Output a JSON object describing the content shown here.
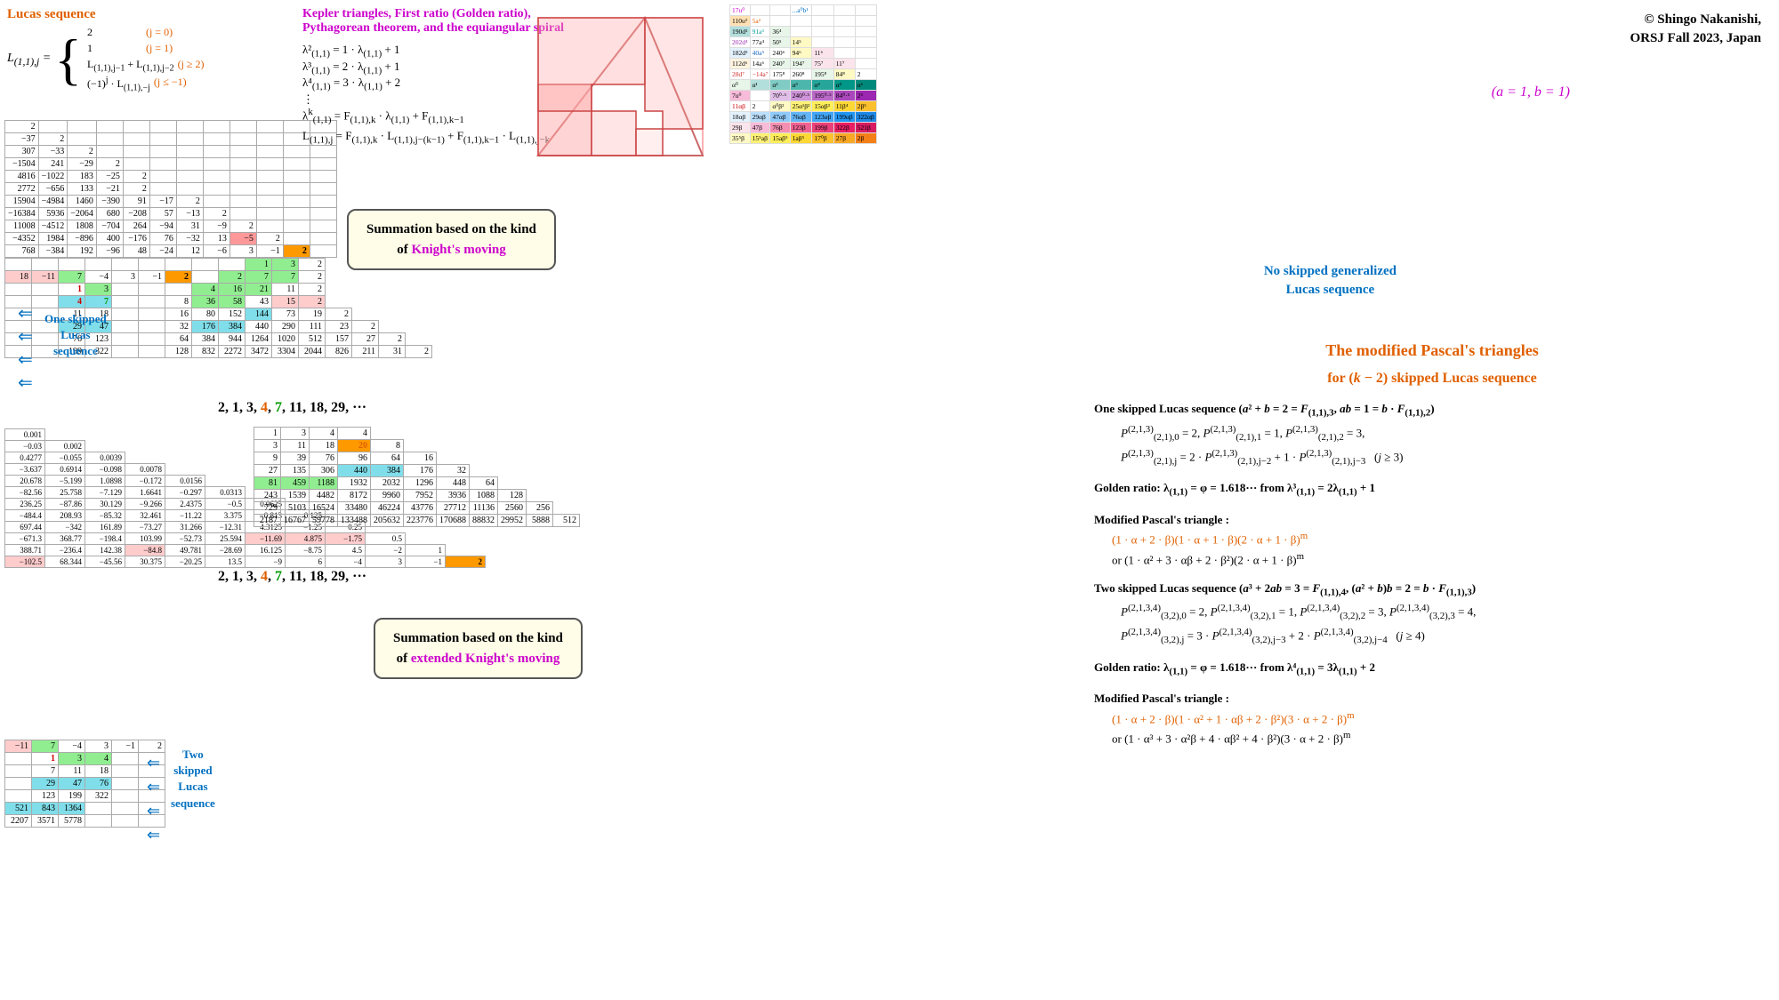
{
  "copyright": {
    "line1": "© Shingo Nakanishi,",
    "line2": "ORSJ Fall 2023, Japan"
  },
  "lucas_title": "Lucas sequence",
  "lucas_subscript": "(1,1),j",
  "ab_label": "(a = 1, b = 1)",
  "kepler_title": "Kepler triangles, First ratio (Golden ratio),",
  "kepler_subtitle": "Pythagorean theorem, and the equiangular spiral",
  "kepler_formulas": [
    "λ²(1,1) = 1 · λ(1,1) + 1",
    "λ³(1,1) = 2 · λ(1,1) + 1",
    "λ⁴(1,1) = 3 · λ(1,1) + 2",
    "⋮",
    "λᵏ(1,1) = F(1,1),k · λ(1,1) + F(1,1),k−1",
    "L(1,1),j = F(1,1),k · L(1,1),j−(k−1) + F(1,1),k−1 · L(1,1),j−k"
  ],
  "callout1": {
    "line1": "Summation based on the kind",
    "line2": "of Knight's moving",
    "highlight": "Knight's moving"
  },
  "callout2": {
    "line1": "Summation based on the kind",
    "line2": "of extended Knight's moving",
    "highlight": "extended Knight's moving"
  },
  "no_skipped_label": "No skipped generalized\nLucas sequence",
  "one_skipped_label": "One skipped\nLucas\nsequence",
  "two_skipped_label": "Two\nskipped\nLucas\nsequence",
  "sequence1": "2, 1, 3, 4, 7, 11, 18, 29, ···",
  "sequence2": "2, 1, 3, 4, 7, 11, 18, 29, ···",
  "modified_title": "The modified Pascal's triangles",
  "modified_subtitle": "for (k − 2) skipped Lucas sequence",
  "formula_blocks": {
    "one_skipped": {
      "label": "One skipped Lucas sequence (a² + b = 2 = F(1,1),3, ab = 1 = b · F(1,1),2)",
      "lines": [
        "P(2,1,3)(2,1),0 = 2, P(2,1,3)(2,1),1 = 1, P(2,1,3)(2,1),2 = 3,",
        "P(2,1,3)(2,1),j = 2 · P(2,1,3)(2,1),j−2 + 1 · P(2,1,3)(2,1),j−3   (j ≥ 3)"
      ]
    },
    "golden_ratio1": {
      "label": "Golden ratio: λ(1,1) = φ = 1.618··· from λ³(1,1) = 2λ(1,1) + 1"
    },
    "modified_triangle1": {
      "label": "Modified Pascal's triangle :",
      "lines": [
        "(1 · α + 2 · β)(1 · α + 1 · β)(2 · α + 1 · β)ᵐ",
        "or (1 · α² + 3 · αβ + 2 · β²)(2 · α + 1 · β)ᵐ"
      ]
    },
    "two_skipped": {
      "label": "Two skipped Lucas sequence (a³ + 2ab = 3 = F(1,1),4, (a² + b)b = 2 = b · F(1,1),3)",
      "lines": [
        "P(2,1,3,4)(3,2),0 = 2, P(2,1,3,4)(3,2),1 = 1, P(2,1,3,4)(3,2),2 = 3, P(2,1,3,4)(3,2),3 = 4,",
        "P(2,1,3,4)(3,2),j = 3 · P(2,1,3,4)(3,2),j−3 + 2 · P(2,1,3,4)(3,2),j−4   (j ≥ 4)"
      ]
    },
    "golden_ratio2": {
      "label": "Golden ratio: λ(1,1) = φ = 1.618··· from λ⁴(1,1) = 3λ(1,1) + 2"
    },
    "modified_triangle2": {
      "label": "Modified Pascal's triangle :",
      "lines": [
        "(1 · α + 2 · β)(1 · α² + 1 · αβ + 2 · β²)(3 · α + 2 · β)ᵐ",
        "or (1 · α³ + 3 · α²β + 4 · αβ² + 4 · β²)(3 · α + 2 · β)ᵐ"
      ]
    }
  }
}
